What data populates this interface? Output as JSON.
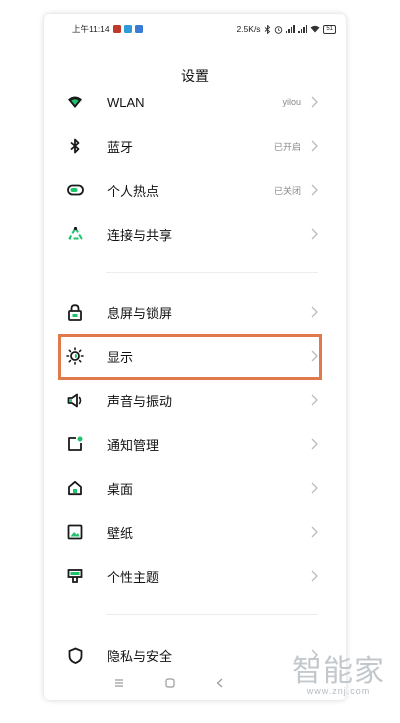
{
  "status_bar": {
    "time": "上午11:14",
    "network_speed": "2.5K/s",
    "battery": "51"
  },
  "page_title": "设置",
  "groups": [
    {
      "items": [
        {
          "id": "wlan",
          "icon": "wifi-icon",
          "label": "WLAN",
          "value": "yilou"
        },
        {
          "id": "bluetooth",
          "icon": "bluetooth-icon",
          "label": "蓝牙",
          "value": "已开启"
        },
        {
          "id": "hotspot",
          "icon": "hotspot-icon",
          "label": "个人热点",
          "value": "已关闭"
        },
        {
          "id": "connection",
          "icon": "share-connection-icon",
          "label": "连接与共享",
          "value": ""
        }
      ]
    },
    {
      "items": [
        {
          "id": "lockscreen",
          "icon": "lock-icon",
          "label": "息屏与锁屏",
          "value": ""
        },
        {
          "id": "display",
          "icon": "brightness-icon",
          "label": "显示",
          "value": ""
        },
        {
          "id": "sound",
          "icon": "speaker-icon",
          "label": "声音与振动",
          "value": ""
        },
        {
          "id": "notifications",
          "icon": "notification-icon",
          "label": "通知管理",
          "value": ""
        },
        {
          "id": "desktop",
          "icon": "home-icon",
          "label": "桌面",
          "value": ""
        },
        {
          "id": "wallpaper",
          "icon": "image-icon",
          "label": "壁纸",
          "value": ""
        },
        {
          "id": "theme",
          "icon": "theme-icon",
          "label": "个性主题",
          "value": ""
        }
      ]
    },
    {
      "items": [
        {
          "id": "privacy",
          "icon": "privacy-icon",
          "label": "隐私与安全",
          "value": ""
        }
      ]
    }
  ],
  "highlighted_item": "display",
  "watermark": {
    "text": "智能家",
    "url": "www.znj.com"
  },
  "colors": {
    "accent_green": "#1ec36b",
    "highlight_orange": "#e07a4a",
    "icon_dark": "#1a1a1a"
  }
}
